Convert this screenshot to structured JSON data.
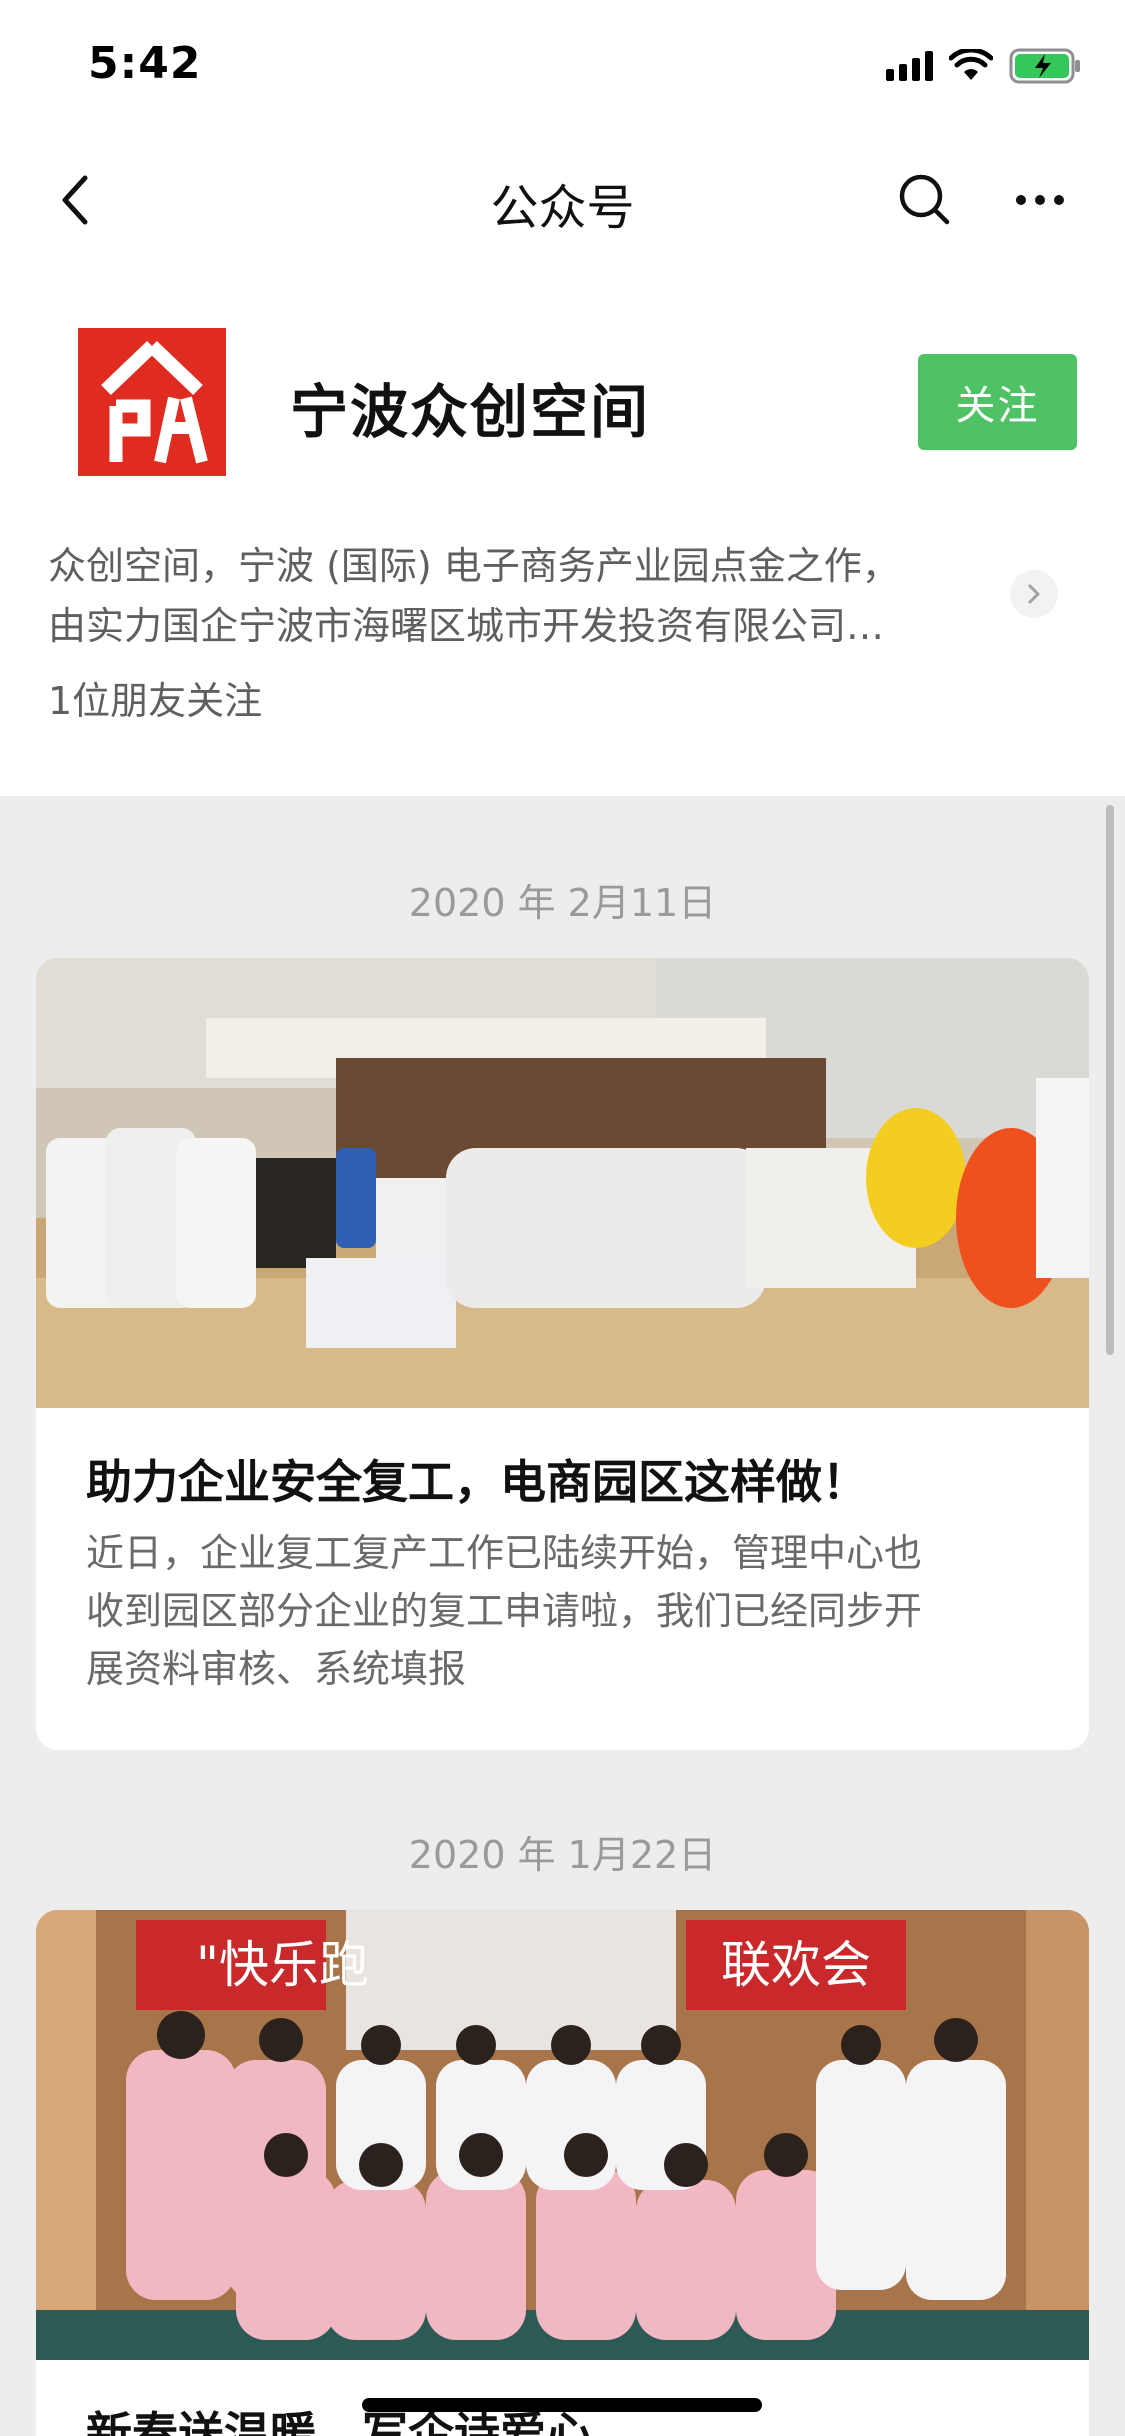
{
  "status_bar": {
    "time": "5:42"
  },
  "nav": {
    "title": "公众号"
  },
  "account": {
    "name": "宁波众创空间",
    "follow_label": "关注",
    "description_line1": "众创空间，宁波 (国际) 电子商务产业园点金之作，",
    "description_line2": "由实力国企宁波市海曙区城市开发投资有限公司…",
    "friends_following": "1位朋友关注"
  },
  "articles": [
    {
      "date": "2020 年 2月11日",
      "title": "助力企业安全复工，电商园区这样做！",
      "summary_line1": "近日，企业复工复产工作已陆续开始，管理中心也",
      "summary_line2": "收到园区部分企业的复工申请啦，我们已经同步开",
      "summary_line3": "展资料审核、系统填报"
    },
    {
      "date": "2020 年 1月22日",
      "banner_text_left": "\"快乐跑",
      "banner_text_right": "联欢会",
      "title": "新春送温暖，写企诗爱心"
    }
  ],
  "colors": {
    "follow_green": "#4fc265",
    "logo_red": "#e02b20",
    "battery_green": "#34c759"
  }
}
